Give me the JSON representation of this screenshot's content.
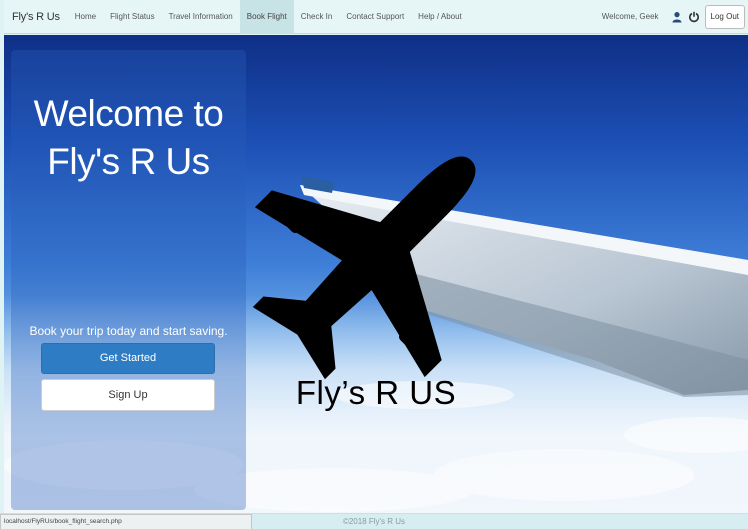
{
  "nav": {
    "brand": "Fly's R Us",
    "links": [
      "Home",
      "Flight Status",
      "Travel Information",
      "Book Flight",
      "Check In",
      "Contact Support",
      "Help / About"
    ],
    "active_link": "Book Flight",
    "welcome": "Welcome, Geek",
    "logout_label": "Log Out"
  },
  "hero": {
    "title": "Welcome to Fly's R Us",
    "tagline": "Book your trip today and start saving.",
    "get_started_label": "Get Started",
    "signup_label": "Sign Up",
    "logo_text": "Fly’s R US"
  },
  "footer": {
    "copyright": "©2018 Fly's R Us",
    "status_url": "localhost/FlyRUs/book_flight_search.php"
  },
  "icons": {
    "user": "user-icon",
    "logout": "power-icon",
    "logo": "airplane-icon"
  },
  "colors": {
    "nav_bg": "#e6f6f7",
    "primary_button": "#2e7dc4",
    "sky": "#1c4fb4"
  }
}
